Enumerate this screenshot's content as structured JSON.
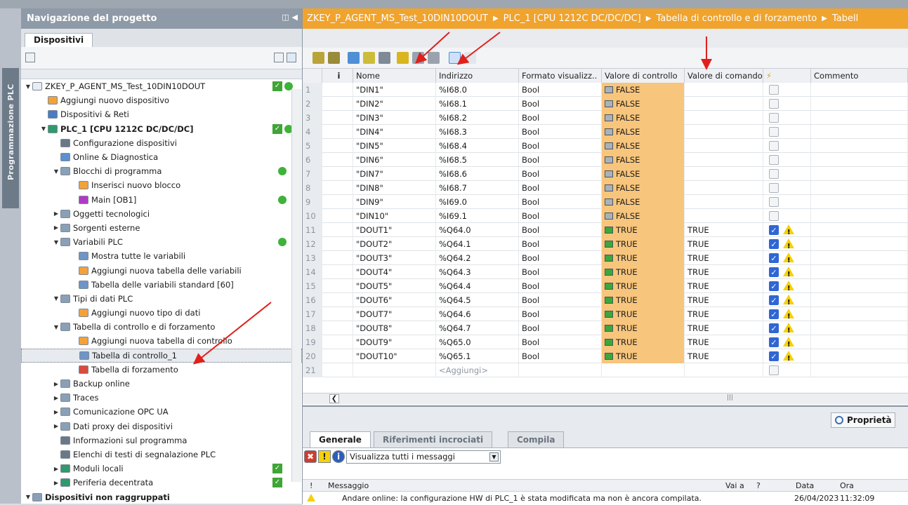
{
  "sidebar": {
    "label": "Programmazione PLC"
  },
  "nav": {
    "title": "Navigazione del progetto",
    "tab": "Dispositivi",
    "tree": [
      {
        "label": "ZKEY_P_AGENT_MS_Test_10DIN10DOUT",
        "indent": 0,
        "twisty": "down",
        "icon": "#e8edf3",
        "status": "check-dot"
      },
      {
        "label": "Aggiungi nuovo dispositivo",
        "indent": 1,
        "twisty": "",
        "icon": "#f3a23a",
        "status": ""
      },
      {
        "label": "Dispositivi & Reti",
        "indent": 1,
        "twisty": "",
        "icon": "#4b7ec1",
        "status": ""
      },
      {
        "label": "PLC_1 [CPU 1212C DC/DC/DC]",
        "indent": 1,
        "twisty": "down",
        "icon": "#2f9a6b",
        "status": "check-dot",
        "bold": true
      },
      {
        "label": "Configurazione dispositivi",
        "indent": 2,
        "twisty": "",
        "icon": "#6b7888",
        "status": ""
      },
      {
        "label": "Online & Diagnostica",
        "indent": 2,
        "twisty": "",
        "icon": "#5b8fd0",
        "status": ""
      },
      {
        "label": "Blocchi di programma",
        "indent": 2,
        "twisty": "down",
        "icon": "#8aa0b6",
        "status": "dot"
      },
      {
        "label": "Inserisci nuovo blocco",
        "indent": 3,
        "twisty": "",
        "icon": "#f3a23a",
        "status": ""
      },
      {
        "label": "Main [OB1]",
        "indent": 3,
        "twisty": "",
        "icon": "#b03ac8",
        "status": "dot"
      },
      {
        "label": "Oggetti tecnologici",
        "indent": 2,
        "twisty": "right",
        "icon": "#8aa0b6",
        "status": ""
      },
      {
        "label": "Sorgenti esterne",
        "indent": 2,
        "twisty": "right",
        "icon": "#8aa0b6",
        "status": ""
      },
      {
        "label": "Variabili PLC",
        "indent": 2,
        "twisty": "down",
        "icon": "#8aa0b6",
        "status": "dot"
      },
      {
        "label": "Mostra tutte le variabili",
        "indent": 3,
        "twisty": "",
        "icon": "#6f94c8",
        "status": ""
      },
      {
        "label": "Aggiungi nuova tabella delle variabili",
        "indent": 3,
        "twisty": "",
        "icon": "#f3a23a",
        "status": ""
      },
      {
        "label": "Tabella delle variabili standard [60]",
        "indent": 3,
        "twisty": "",
        "icon": "#6f94c8",
        "status": ""
      },
      {
        "label": "Tipi di dati PLC",
        "indent": 2,
        "twisty": "down",
        "icon": "#8aa0b6",
        "status": ""
      },
      {
        "label": "Aggiungi nuovo tipo di dati",
        "indent": 3,
        "twisty": "",
        "icon": "#f3a23a",
        "status": ""
      },
      {
        "label": "Tabella di controllo e di forzamento",
        "indent": 2,
        "twisty": "down",
        "icon": "#8aa0b6",
        "status": ""
      },
      {
        "label": "Aggiungi nuova tabella di controllo",
        "indent": 3,
        "twisty": "",
        "icon": "#f3a23a",
        "status": ""
      },
      {
        "label": "Tabella di controllo_1",
        "indent": 3,
        "twisty": "",
        "icon": "#6f94c8",
        "status": "",
        "selected": true
      },
      {
        "label": "Tabella di forzamento",
        "indent": 3,
        "twisty": "",
        "icon": "#d94b3c",
        "status": ""
      },
      {
        "label": "Backup online",
        "indent": 2,
        "twisty": "right",
        "icon": "#8aa0b6",
        "status": ""
      },
      {
        "label": "Traces",
        "indent": 2,
        "twisty": "right",
        "icon": "#8aa0b6",
        "status": ""
      },
      {
        "label": "Comunicazione OPC UA",
        "indent": 2,
        "twisty": "right",
        "icon": "#8aa0b6",
        "status": ""
      },
      {
        "label": "Dati proxy dei dispositivi",
        "indent": 2,
        "twisty": "right",
        "icon": "#8aa0b6",
        "status": ""
      },
      {
        "label": "Informazioni sul programma",
        "indent": 2,
        "twisty": "",
        "icon": "#6b7888",
        "status": ""
      },
      {
        "label": "Elenchi di testi di segnalazione PLC",
        "indent": 2,
        "twisty": "",
        "icon": "#6b7888",
        "status": ""
      },
      {
        "label": "Moduli locali",
        "indent": 2,
        "twisty": "right",
        "icon": "#2f9a6b",
        "status": "check"
      },
      {
        "label": "Periferia decentrata",
        "indent": 2,
        "twisty": "right",
        "icon": "#2f9a6b",
        "status": "check"
      },
      {
        "label": "Dispositivi non raggruppati",
        "indent": 0,
        "twisty": "down",
        "icon": "#8aa0b6",
        "status": "",
        "bold": true
      }
    ]
  },
  "breadcrumb": [
    "ZKEY_P_AGENT_MS_Test_10DIN10DOUT",
    "PLC_1 [CPU 1212C DC/DC/DC]",
    "Tabella di controllo e di forzamento",
    "Tabell"
  ],
  "table": {
    "headers": {
      "i": "i",
      "nome": "Nome",
      "indirizzo": "Indirizzo",
      "formato": "Formato visualizz..",
      "controllo": "Valore di controllo",
      "comando": "Valore di comando",
      "commento": "Commento"
    },
    "rows": [
      {
        "n": "1",
        "nome": "\"DIN1\"",
        "ind": "%I68.0",
        "fmt": "Bool",
        "ctrl": "FALSE",
        "cmd": "",
        "on": false
      },
      {
        "n": "2",
        "nome": "\"DIN2\"",
        "ind": "%I68.1",
        "fmt": "Bool",
        "ctrl": "FALSE",
        "cmd": "",
        "on": false
      },
      {
        "n": "3",
        "nome": "\"DIN3\"",
        "ind": "%I68.2",
        "fmt": "Bool",
        "ctrl": "FALSE",
        "cmd": "",
        "on": false
      },
      {
        "n": "4",
        "nome": "\"DIN4\"",
        "ind": "%I68.3",
        "fmt": "Bool",
        "ctrl": "FALSE",
        "cmd": "",
        "on": false
      },
      {
        "n": "5",
        "nome": "\"DIN5\"",
        "ind": "%I68.4",
        "fmt": "Bool",
        "ctrl": "FALSE",
        "cmd": "",
        "on": false
      },
      {
        "n": "6",
        "nome": "\"DIN6\"",
        "ind": "%I68.5",
        "fmt": "Bool",
        "ctrl": "FALSE",
        "cmd": "",
        "on": false
      },
      {
        "n": "7",
        "nome": "\"DIN7\"",
        "ind": "%I68.6",
        "fmt": "Bool",
        "ctrl": "FALSE",
        "cmd": "",
        "on": false
      },
      {
        "n": "8",
        "nome": "\"DIN8\"",
        "ind": "%I68.7",
        "fmt": "Bool",
        "ctrl": "FALSE",
        "cmd": "",
        "on": false
      },
      {
        "n": "9",
        "nome": "\"DIN9\"",
        "ind": "%I69.0",
        "fmt": "Bool",
        "ctrl": "FALSE",
        "cmd": "",
        "on": false
      },
      {
        "n": "10",
        "nome": "\"DIN10\"",
        "ind": "%I69.1",
        "fmt": "Bool",
        "ctrl": "FALSE",
        "cmd": "",
        "on": false
      },
      {
        "n": "11",
        "nome": "\"DOUT1\"",
        "ind": "%Q64.0",
        "fmt": "Bool",
        "ctrl": "TRUE",
        "cmd": "TRUE",
        "on": true
      },
      {
        "n": "12",
        "nome": "\"DOUT2\"",
        "ind": "%Q64.1",
        "fmt": "Bool",
        "ctrl": "TRUE",
        "cmd": "TRUE",
        "on": true
      },
      {
        "n": "13",
        "nome": "\"DOUT3\"",
        "ind": "%Q64.2",
        "fmt": "Bool",
        "ctrl": "TRUE",
        "cmd": "TRUE",
        "on": true
      },
      {
        "n": "14",
        "nome": "\"DOUT4\"",
        "ind": "%Q64.3",
        "fmt": "Bool",
        "ctrl": "TRUE",
        "cmd": "TRUE",
        "on": true
      },
      {
        "n": "15",
        "nome": "\"DOUT5\"",
        "ind": "%Q64.4",
        "fmt": "Bool",
        "ctrl": "TRUE",
        "cmd": "TRUE",
        "on": true
      },
      {
        "n": "16",
        "nome": "\"DOUT6\"",
        "ind": "%Q64.5",
        "fmt": "Bool",
        "ctrl": "TRUE",
        "cmd": "TRUE",
        "on": true
      },
      {
        "n": "17",
        "nome": "\"DOUT7\"",
        "ind": "%Q64.6",
        "fmt": "Bool",
        "ctrl": "TRUE",
        "cmd": "TRUE",
        "on": true
      },
      {
        "n": "18",
        "nome": "\"DOUT8\"",
        "ind": "%Q64.7",
        "fmt": "Bool",
        "ctrl": "TRUE",
        "cmd": "TRUE",
        "on": true
      },
      {
        "n": "19",
        "nome": "\"DOUT9\"",
        "ind": "%Q65.0",
        "fmt": "Bool",
        "ctrl": "TRUE",
        "cmd": "TRUE",
        "on": true
      },
      {
        "n": "20",
        "nome": "\"DOUT10\"",
        "ind": "%Q65.1",
        "fmt": "Bool",
        "ctrl": "TRUE",
        "cmd": "TRUE",
        "on": true
      }
    ],
    "add_row": {
      "n": "21",
      "label": "<Aggiungi>"
    }
  },
  "inspector": {
    "properties_label": "Proprietà",
    "tabs": [
      "Generale",
      "Riferimenti incrociati",
      "Compila"
    ],
    "filter_label": "Visualizza tutti i messaggi",
    "columns": {
      "bang": "!",
      "messaggio": "Messaggio",
      "vai": "Vai a",
      "q": "?",
      "data": "Data",
      "ora": "Ora"
    },
    "message": {
      "text": "Andare online: la configurazione HW di PLC_1 è stata modificata ma non è ancora compilata.",
      "date": "26/04/2023",
      "time": "11:32:09"
    }
  },
  "colors": {
    "accent_orange": "#f0a32d",
    "nav_header": "#8e9aa7",
    "annotation_arrow": "#e0201c"
  }
}
